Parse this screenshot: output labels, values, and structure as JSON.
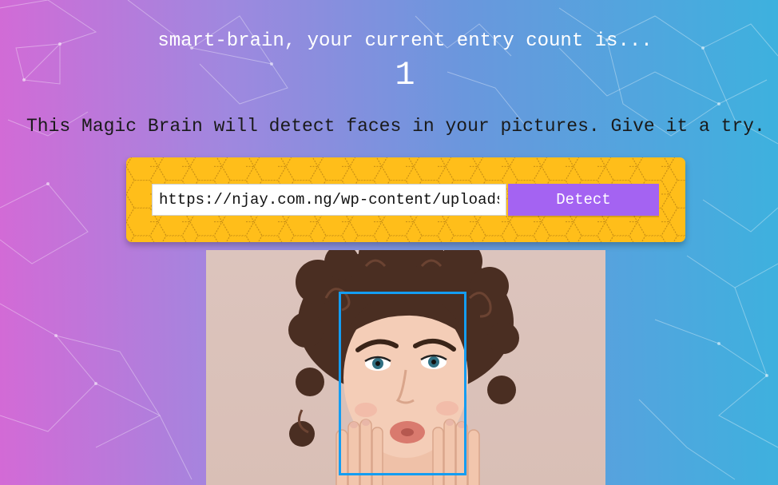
{
  "header": {
    "greeting": "smart-brain, your current entry count is...",
    "entry_count": "1"
  },
  "intro": {
    "text": "This Magic Brain will detect faces in your pictures. Give it a try."
  },
  "form": {
    "input_value": "https://njay.com.ng/wp-content/uploads/",
    "button_label": "Detect"
  },
  "image": {
    "subject": "woman with curly hair, hands on cheeks",
    "face_box_color": "#149df2"
  },
  "colors": {
    "gradient_left": "#d36ad6",
    "gradient_right": "#3db1de",
    "panel": "#ffbe1a",
    "button": "#a463f2"
  }
}
